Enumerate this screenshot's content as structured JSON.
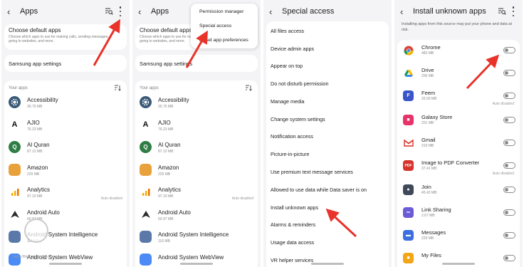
{
  "colors": {
    "accent_arrow": "#e8322a",
    "panel_bg": "#f4f4f6",
    "card_bg": "#ffffff",
    "toggle": "#8a8a8a"
  },
  "apps_screen": {
    "title": "Apps",
    "default_apps": {
      "heading": "Choose default apps",
      "description": "Choose which apps to use for making calls, sending messages, going to websites, and more."
    },
    "samsung_settings": "Samsung app settings",
    "your_apps": "Your apps",
    "items": [
      {
        "name": "Accessibility",
        "size": "30.75 MB",
        "auto": ""
      },
      {
        "name": "AJIO",
        "size": "76.23 MB",
        "auto": ""
      },
      {
        "name": "Al Quran",
        "size": "87.12 MB",
        "auto": ""
      },
      {
        "name": "Amazon",
        "size": "229 MB",
        "auto": ""
      },
      {
        "name": "Analytics",
        "size": "97.10 MB",
        "auto": "Auto disabled"
      },
      {
        "name": "Android Auto",
        "size": "60.97 MB",
        "auto": ""
      },
      {
        "name": "Android System Intelligence",
        "size": "116 MB",
        "auto": ""
      },
      {
        "name": "Android System WebView",
        "size": "",
        "auto": ""
      }
    ],
    "icons": [
      "gear-icon",
      "ajio-logo-icon",
      "quran-icon",
      "amazon-icon",
      "analytics-icon",
      "android-auto-icon",
      "system-intelligence-icon",
      "webview-icon"
    ]
  },
  "menu": {
    "items": [
      "Permission manager",
      "Special access",
      "Reset app preferences"
    ]
  },
  "special_access": {
    "title": "Special access",
    "items": [
      "All files access",
      "Device admin apps",
      "Appear on top",
      "Do not disturb permission",
      "Manage media",
      "Change system settings",
      "Notification access",
      "Picture-in-picture",
      "Use premium text message services",
      "Allowed to use data while Data saver is on",
      "Install unknown apps",
      "Alarms & reminders",
      "Usage data access",
      "VR helper services"
    ]
  },
  "install_unknown": {
    "title": "Install unknown apps",
    "description": "Installing apps from this source may put your phone and data at risk.",
    "items": [
      {
        "name": "Chrome",
        "size": "483 MB",
        "auto": ""
      },
      {
        "name": "Drive",
        "size": "206 MB",
        "auto": ""
      },
      {
        "name": "Feem",
        "size": "33.00 MB",
        "auto": "Auto disabled"
      },
      {
        "name": "Galaxy Store",
        "size": "201 MB",
        "auto": ""
      },
      {
        "name": "Gmail",
        "size": "319 MB",
        "auto": ""
      },
      {
        "name": "Image to PDF Converter",
        "size": "37.41 MB",
        "auto": "Auto disabled"
      },
      {
        "name": "Join",
        "size": "45.43 MB",
        "auto": ""
      },
      {
        "name": "Link Sharing",
        "size": "2.67 MB",
        "auto": ""
      },
      {
        "name": "Messages",
        "size": "229 MB",
        "auto": ""
      },
      {
        "name": "My Files",
        "size": "",
        "auto": ""
      }
    ],
    "toggles_on": [
      false,
      false,
      false,
      false,
      false,
      false,
      false,
      false,
      false,
      false
    ]
  },
  "watermark": "https://fileCodeRecipe.com"
}
